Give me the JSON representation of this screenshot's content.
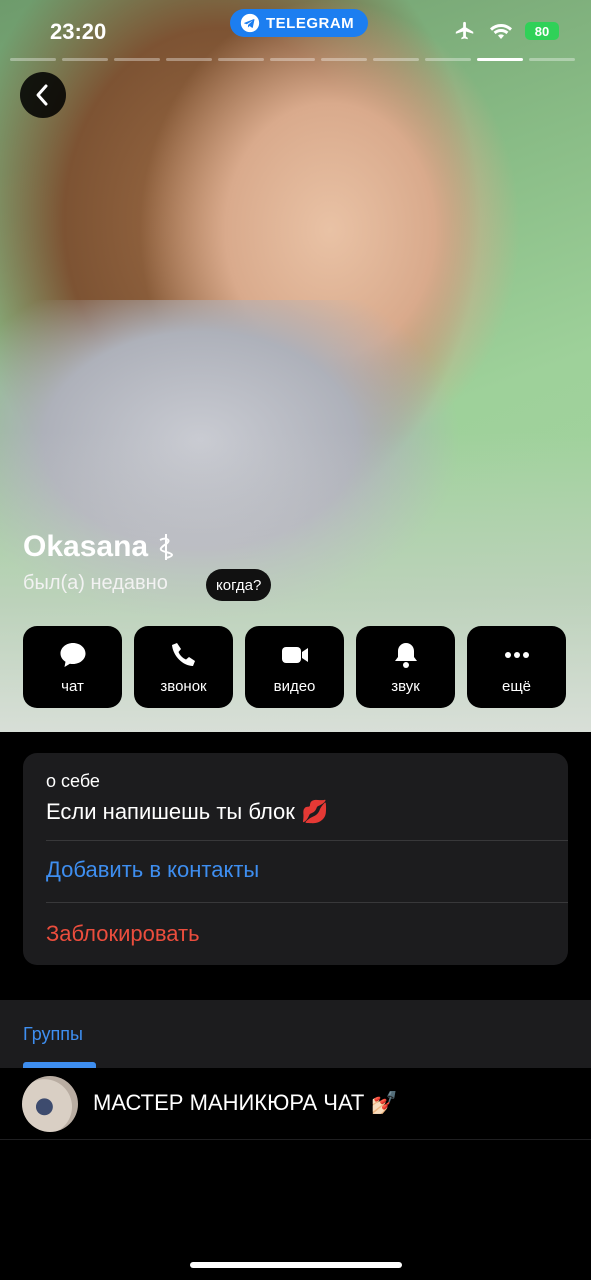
{
  "status_bar": {
    "time": "23:20",
    "app_label": "TELEGRAM",
    "battery": "80"
  },
  "profile": {
    "name": "Okasana",
    "status": "был(а) недавно",
    "when_label": "когда?"
  },
  "actions": [
    {
      "label": "чат",
      "icon": "chat-bubble-icon"
    },
    {
      "label": "звонок",
      "icon": "phone-icon"
    },
    {
      "label": "видео",
      "icon": "video-camera-icon"
    },
    {
      "label": "звук",
      "icon": "bell-icon"
    },
    {
      "label": "ещё",
      "icon": "more-dots-icon"
    }
  ],
  "info": {
    "about_label": "о себе",
    "about_text": "Если напишешь ты блок 💋",
    "add_contact": "Добавить в контакты",
    "block": "Заблокировать"
  },
  "tabs": {
    "groups": "Группы"
  },
  "groups": [
    {
      "title": "МАСТЕР МАНИКЮРА ЧАТ 💅🏻"
    }
  ],
  "colors": {
    "accent": "#3e8ef0",
    "danger": "#eb4d3d",
    "card": "#1c1c1e",
    "telegram": "#1c7ef0"
  }
}
